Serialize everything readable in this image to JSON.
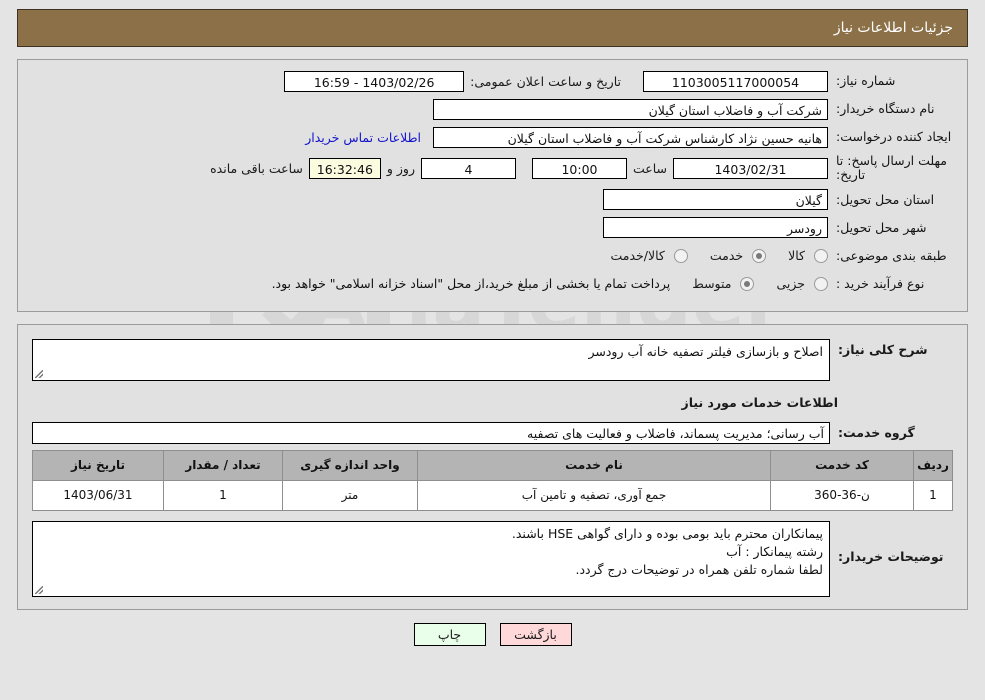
{
  "header": {
    "title": "جزئیات اطلاعات نیاز"
  },
  "form": {
    "need_number_label": "شماره نیاز:",
    "need_number_value": "1103005117000054",
    "public_announce_label": "تاریخ و ساعت اعلان عمومی:",
    "public_announce_value": "1403/02/26 - 16:59",
    "buyer_org_label": "نام دستگاه خریدار:",
    "buyer_org_value": "شرکت آب و فاضلاب استان گیلان",
    "creator_label": "ایجاد کننده درخواست:",
    "creator_value": "هانیه حسین نژاد کارشناس شرکت آب و فاضلاب استان گیلان",
    "contact_link": "اطلاعات تماس خریدار",
    "deadline_label": "مهلت ارسال پاسخ: تا تاریخ:",
    "deadline_date": "1403/02/31",
    "hour_label": "ساعت",
    "deadline_time": "10:00",
    "days_value": "4",
    "days_and_label": "روز و",
    "timer_value": "16:32:46",
    "remaining_label": "ساعت باقی مانده",
    "province_label": "استان محل تحویل:",
    "province_value": "گیلان",
    "city_label": "شهر محل تحویل:",
    "city_value": "رودسر",
    "category_label": "طبقه بندی موضوعی:",
    "category_options": [
      {
        "label": "کالا",
        "selected": false
      },
      {
        "label": "خدمت",
        "selected": true
      },
      {
        "label": "کالا/خدمت",
        "selected": false
      }
    ],
    "process_label": "نوع فرآیند خرید :",
    "process_options": [
      {
        "label": "جزیی",
        "selected": false
      },
      {
        "label": "متوسط",
        "selected": true
      }
    ],
    "process_note": "پرداخت تمام یا بخشی از مبلغ خرید،از محل \"اسناد خزانه اسلامی\" خواهد بود."
  },
  "details": {
    "general_desc_label": "شرح کلی نیاز:",
    "general_desc_value": "اصلاح و بازسازی فیلتر تصفیه خانه آب رودسر",
    "services_head": "اطلاعات خدمات مورد نیاز",
    "service_group_label": "گروه خدمت:",
    "service_group_value": "آب رسانی؛ مدیریت پسماند، فاضلاب و فعالیت های تصفیه",
    "table": {
      "columns": [
        "ردیف",
        "کد خدمت",
        "نام خدمت",
        "واحد اندازه گیری",
        "تعداد / مقدار",
        "تاریخ نیاز"
      ],
      "rows": [
        {
          "index": "1",
          "code": "ن-36-360",
          "name": "جمع آوری، تصفیه و تامین آب",
          "unit": "متر",
          "qty": "1",
          "date": "1403/06/31"
        }
      ]
    },
    "buyer_notes_label": "توضیحات خریدار:",
    "buyer_notes_lines": [
      "پیمانکاران محترم باید بومی بوده و دارای گواهی HSE  باشند.",
      "رشته پیمانکار :  آب",
      "لطفا شماره تلفن همراه در توضیحات درج گردد."
    ]
  },
  "footer": {
    "print_label": "چاپ",
    "back_label": "بازگشت"
  },
  "colors": {
    "titlebar": "#8c7047",
    "page_bg": "#e4e4e4",
    "panel_bg": "#e1e1e1",
    "table_header": "#b4b4b4",
    "link": "#1414cc",
    "timer_bg": "#fbfbe0",
    "print_btn": "#eaffea",
    "back_btn": "#ffd9d9"
  },
  "watermark": {
    "text": "AriaTender.net"
  }
}
